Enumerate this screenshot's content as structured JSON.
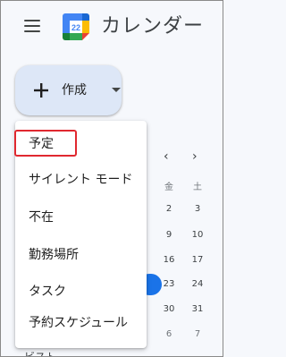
{
  "header": {
    "app_title": "カレンダー",
    "logo_day": "22"
  },
  "create_button": {
    "label": "作成"
  },
  "create_menu": {
    "items": [
      {
        "label": "予定",
        "highlighted": true
      },
      {
        "label": "サイレント モード"
      },
      {
        "label": "不在"
      },
      {
        "label": "勤務場所"
      },
      {
        "label": "タスク"
      },
      {
        "label": "予約スケジュール"
      }
    ]
  },
  "mini_calendar": {
    "prev_icon": "chevron-left-icon",
    "next_icon": "chevron-right-icon",
    "weekdays": [
      "金",
      "土"
    ],
    "rows": [
      [
        "2",
        "3"
      ],
      [
        "9",
        "10"
      ],
      [
        "16",
        "17"
      ],
      [
        "23",
        "24"
      ],
      [
        "30",
        "31"
      ],
      [
        "6",
        "7"
      ]
    ]
  },
  "partially_hidden_text": "ビスト",
  "colors": {
    "accent_blue": "#1a73e8",
    "create_button_bg": "#dde7f7",
    "highlight_red": "#e0282f",
    "page_bg": "#f6f8fc"
  }
}
